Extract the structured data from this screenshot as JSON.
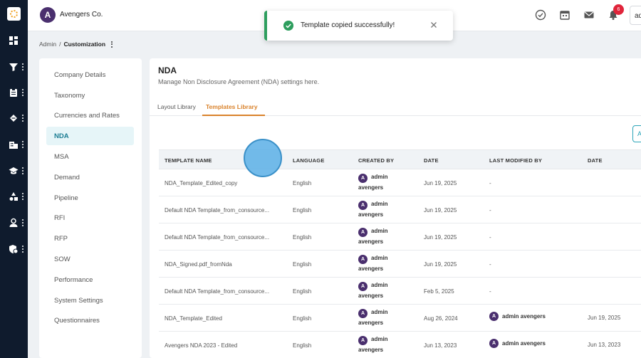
{
  "colors": {
    "accent": "#d9822b",
    "teal": "#1c7d93",
    "success": "#2e9e5e",
    "badge": "#e0243a",
    "rail": "#0f1b2d"
  },
  "rail": {
    "logo": "app-logo",
    "items": [
      "dashboard-icon",
      "funnel-icon",
      "clipboard-icon",
      "handshake-icon",
      "building-icon",
      "graduation-cap-icon",
      "shapes-icon",
      "user-icon",
      "shield-gear-icon"
    ]
  },
  "topbar": {
    "brand_initial": "A",
    "brand_name": "Avengers Co.",
    "icons": [
      "check-circle-icon",
      "calendar-icon",
      "mail-icon",
      "bell-icon"
    ],
    "notification_count": "6",
    "user_label": "ad"
  },
  "breadcrumb": {
    "root": "Admin",
    "separator": "/",
    "current": "Customization"
  },
  "menu": {
    "items": [
      "Company Details",
      "Taxonomy",
      "Currencies and Rates",
      "NDA",
      "MSA",
      "Demand",
      "Pipeline",
      "RFI",
      "RFP",
      "SOW",
      "Performance",
      "System Settings",
      "Questionnaires"
    ],
    "active": "NDA"
  },
  "main": {
    "title": "NDA",
    "description": "Manage Non Disclosure Agreement (NDA) settings here.",
    "tabs": [
      "Layout Library",
      "Templates Library"
    ],
    "active_tab": "Templates Library",
    "add_button": "A"
  },
  "table": {
    "headers": [
      "TEMPLATE NAME",
      "LANGUAGE",
      "CREATED BY",
      "DATE",
      "LAST MODIFIED BY",
      "DATE"
    ],
    "rows": [
      {
        "name": "NDA_Template_Edited_copy",
        "language": "English",
        "created_first": "admin",
        "created_last": "avengers",
        "date": "Jun 19, 2025",
        "modified_by": "-",
        "modified_date": ""
      },
      {
        "name": "Default NDA Template_from_consource...",
        "language": "English",
        "created_first": "admin",
        "created_last": "avengers",
        "date": "Jun 19, 2025",
        "modified_by": "-",
        "modified_date": ""
      },
      {
        "name": "Default NDA Template_from_consource...",
        "language": "English",
        "created_first": "admin",
        "created_last": "avengers",
        "date": "Jun 19, 2025",
        "modified_by": "-",
        "modified_date": ""
      },
      {
        "name": "NDA_Signed.pdf_fromNda",
        "language": "English",
        "created_first": "admin",
        "created_last": "avengers",
        "date": "Jun 19, 2025",
        "modified_by": "-",
        "modified_date": ""
      },
      {
        "name": "Default NDA Template_from_consource...",
        "language": "English",
        "created_first": "admin",
        "created_last": "avengers",
        "date": "Feb 5, 2025",
        "modified_by": "-",
        "modified_date": ""
      },
      {
        "name": "NDA_Template_Edited",
        "language": "English",
        "created_first": "admin",
        "created_last": "avengers",
        "date": "Aug 26, 2024",
        "modified_by": "admin avengers",
        "modified_date": "Jun 19, 2025"
      },
      {
        "name": "Avengers NDA 2023 - Edited",
        "language": "English",
        "created_first": "admin",
        "created_last": "avengers",
        "date": "Jun 13, 2023",
        "modified_by": "admin avengers",
        "modified_date": "Jun 13, 2023"
      }
    ]
  },
  "toast": {
    "message": "Template copied successfully!",
    "icon": "check-circle-icon",
    "close_icon": "close-icon"
  }
}
